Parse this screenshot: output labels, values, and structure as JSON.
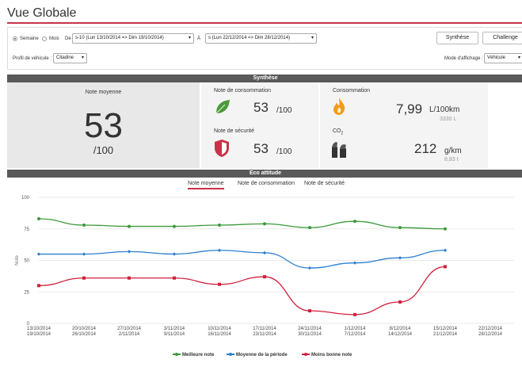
{
  "header": {
    "title": "Vue Globale"
  },
  "filters": {
    "period_options": [
      "Semaine",
      "Mois"
    ],
    "from_label": "De",
    "from_value": "s-10 (Lun 13/10/2014 => Dim 19/10/2014)",
    "to_label": "À",
    "to_value": "s (Lun 22/12/2014 => Dim 28/12/2014)",
    "profile_label": "Profil de véhicule :",
    "profile_value": "Citadine",
    "display_mode_label": "Mode d'affichage :",
    "display_mode_value": "Véhicule",
    "synthese_button": "Synthèse",
    "challenge_button": "Challenge",
    "caret": "▾"
  },
  "synthese": {
    "header": "Synthèse",
    "note_moyenne_label": "Note moyenne",
    "note_moyenne_value": "53",
    "note_moyenne_scale": "/100",
    "conso_label": "Note de consommation",
    "conso_value": "53",
    "conso_scale": "/100",
    "securite_label": "Note de sécurité",
    "securite_value": "53",
    "securite_scale": "/100",
    "consommation_label": "Consommation",
    "consommation_value": "7,99",
    "consommation_unit": "L/100km",
    "consommation_total": "3330 L",
    "co2_label_main": "CO",
    "co2_label_sub": "2",
    "co2_value": "212",
    "co2_unit": "g/km",
    "co2_total": "8,83 t",
    "leaf_color": "#4a9a3a",
    "shield_color": "#c8334a",
    "flame_color": "#f39a1e",
    "factory_color": "#333333"
  },
  "eco": {
    "header": "Eco attitude",
    "tabs": [
      "Note moyenne",
      "Note de consommation",
      "Note de sécurité"
    ],
    "active_tab": 0
  },
  "chart_data": {
    "type": "line",
    "ylabel": "Note",
    "ylim": [
      0,
      100
    ],
    "yticks": [
      0,
      25,
      50,
      75,
      100
    ],
    "categories": [
      "13/10/2014\n19/10/2014",
      "20/10/2014\n26/10/2014",
      "27/10/2014\n2/11/2014",
      "3/11/2014\n9/11/2014",
      "10/11/2014\n16/11/2014",
      "17/11/2014\n23/11/2014",
      "24/11/2014\n30/11/2014",
      "1/12/2014\n7/12/2014",
      "8/12/2014\n14/12/2014",
      "15/12/2014\n21/12/2014",
      "22/12/2014\n28/12/2014"
    ],
    "series": [
      {
        "name": "Meilleure note",
        "color": "#3a9a3a",
        "marker": "circle",
        "values": [
          83,
          78,
          77,
          77,
          78,
          79,
          76,
          81,
          76,
          75,
          null
        ]
      },
      {
        "name": "Moyenne de la période",
        "color": "#2a7fd0",
        "marker": "diamond",
        "values": [
          55,
          55,
          57,
          55,
          58,
          56,
          44,
          48,
          52,
          58,
          null
        ]
      },
      {
        "name": "Moins bonne note",
        "color": "#d0203d",
        "marker": "square",
        "values": [
          30,
          36,
          36,
          36,
          31,
          37,
          10,
          7,
          17,
          45,
          null
        ]
      }
    ]
  }
}
